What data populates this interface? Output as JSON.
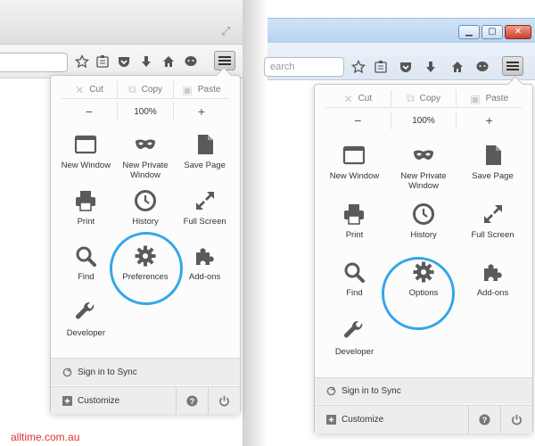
{
  "left_window": {
    "search_placeholder": "",
    "menu": {
      "edit": {
        "cut": "Cut",
        "copy": "Copy",
        "paste": "Paste"
      },
      "zoom": {
        "minus": "−",
        "value": "100%",
        "plus": "+"
      },
      "items": [
        {
          "label": "New Window",
          "icon": "new-window-icon"
        },
        {
          "label": "New Private Window",
          "icon": "private-mask-icon"
        },
        {
          "label": "Save Page",
          "icon": "save-page-icon"
        },
        {
          "label": "Print",
          "icon": "printer-icon"
        },
        {
          "label": "History",
          "icon": "clock-icon"
        },
        {
          "label": "Full Screen",
          "icon": "fullscreen-arrows-icon"
        },
        {
          "label": "Find",
          "icon": "magnifier-icon"
        },
        {
          "label": "Preferences",
          "icon": "gear-icon"
        },
        {
          "label": "Add-ons",
          "icon": "puzzle-icon"
        },
        {
          "label": "Developer",
          "icon": "wrench-icon"
        }
      ],
      "sync": "Sign in to Sync",
      "customize": "Customize"
    }
  },
  "right_window": {
    "search_placeholder": "earch",
    "menu": {
      "edit": {
        "cut": "Cut",
        "copy": "Copy",
        "paste": "Paste"
      },
      "zoom": {
        "minus": "−",
        "value": "100%",
        "plus": "+"
      },
      "items": [
        {
          "label": "New Window",
          "icon": "new-window-icon"
        },
        {
          "label": "New Private Window",
          "icon": "private-mask-icon"
        },
        {
          "label": "Save Page",
          "icon": "save-page-icon"
        },
        {
          "label": "Print",
          "icon": "printer-icon"
        },
        {
          "label": "History",
          "icon": "clock-icon"
        },
        {
          "label": "Full Screen",
          "icon": "fullscreen-arrows-icon"
        },
        {
          "label": "Find",
          "icon": "magnifier-icon"
        },
        {
          "label": "Options",
          "icon": "gear-icon"
        },
        {
          "label": "Add-ons",
          "icon": "puzzle-icon"
        },
        {
          "label": "Developer",
          "icon": "wrench-icon"
        }
      ],
      "sync": "Sign in to Sync",
      "customize": "Customize"
    }
  },
  "watermark": "alltime.com.au",
  "colors": {
    "highlight": "#34a6e8",
    "watermark": "#e03030"
  }
}
